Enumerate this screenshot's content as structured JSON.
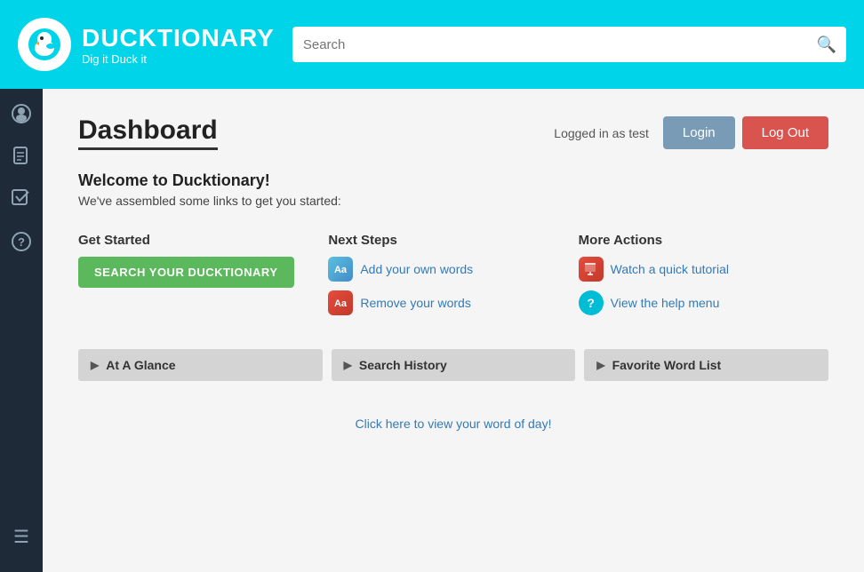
{
  "header": {
    "logo_title": "DUCKTIONARY",
    "logo_subtitle": "Dig it Duck it",
    "search_placeholder": "Search",
    "search_icon": "🔍"
  },
  "sidebar": {
    "items": [
      {
        "name": "duck-icon",
        "symbol": "🐥",
        "active": true
      },
      {
        "name": "document-icon",
        "symbol": "📋",
        "active": false
      },
      {
        "name": "edit-icon",
        "symbol": "✏",
        "active": false
      },
      {
        "name": "help-icon",
        "symbol": "?",
        "active": false
      }
    ],
    "bottom": {
      "name": "menu-icon",
      "symbol": "≡"
    }
  },
  "dashboard": {
    "title": "Dashboard",
    "login_status": "Logged in as test",
    "login_button": "Login",
    "logout_button": "Log Out",
    "welcome_title": "Welcome to Ducktionary!",
    "welcome_subtitle": "We've assembled some links to get you started:",
    "get_started": {
      "title": "Get Started",
      "search_button": "SEARCH YOUR DUCKTIONARY"
    },
    "next_steps": {
      "title": "Next Steps",
      "links": [
        {
          "label": "Add your own words",
          "type": "add"
        },
        {
          "label": "Remove your words",
          "type": "remove"
        }
      ]
    },
    "more_actions": {
      "title": "More Actions",
      "links": [
        {
          "label": "Watch a quick tutorial",
          "type": "tutorial"
        },
        {
          "label": "View the help menu",
          "type": "help"
        }
      ]
    },
    "accordions": [
      {
        "label": "At A Glance"
      },
      {
        "label": "Search History"
      },
      {
        "label": "Favorite Word List"
      }
    ],
    "footer_link": "Click here to view your word of day!"
  }
}
